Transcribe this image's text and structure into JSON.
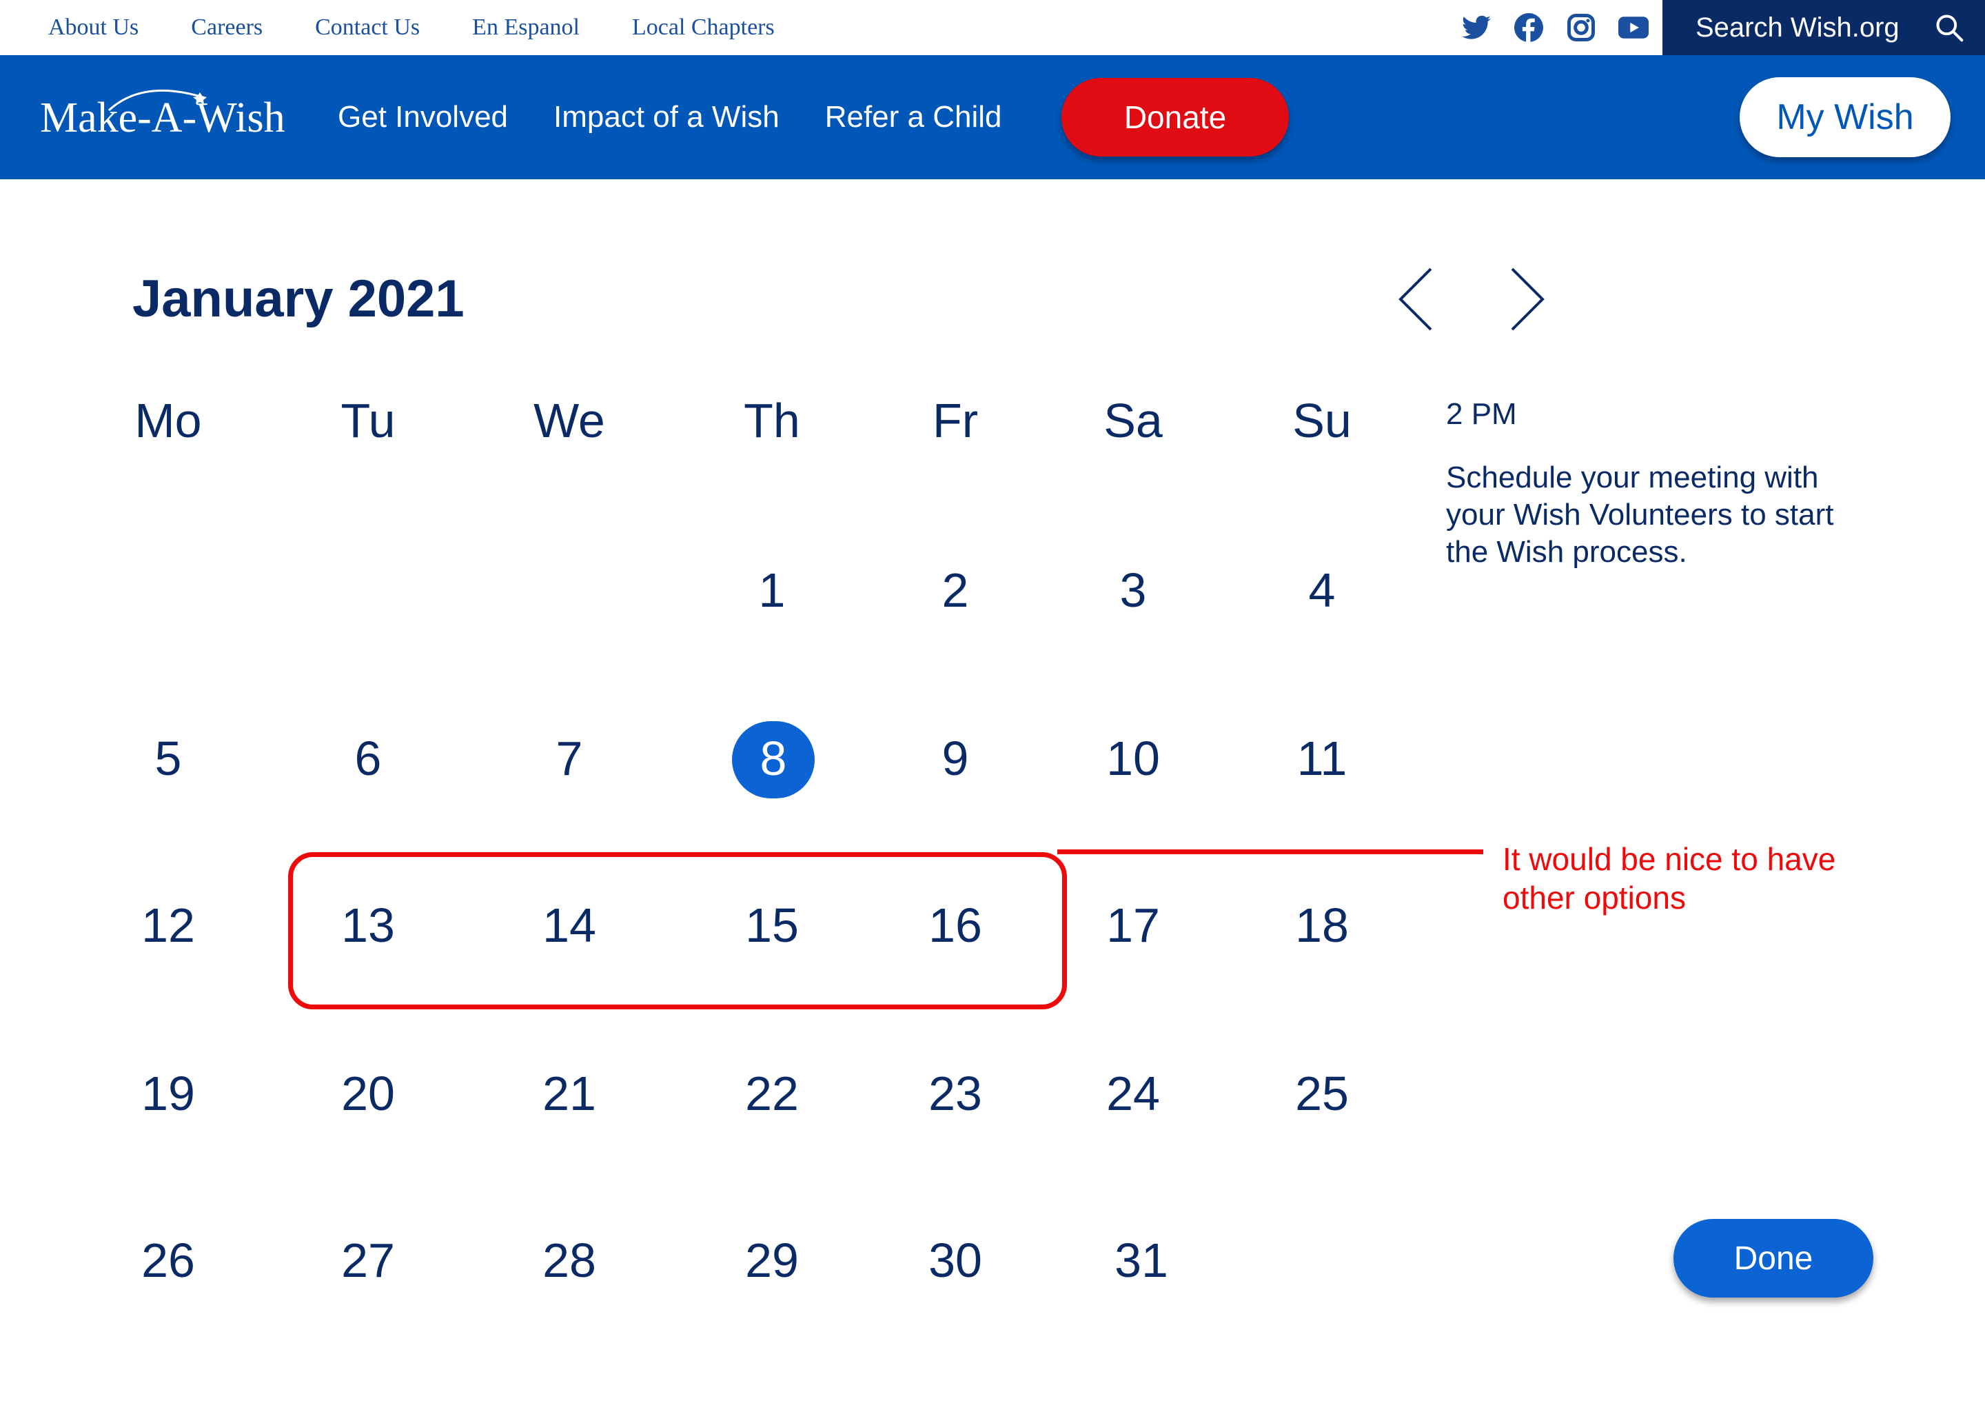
{
  "utility_nav": {
    "links": [
      "About Us",
      "Careers",
      "Contact Us",
      "En Espanol",
      "Local Chapters"
    ],
    "social_icons": [
      "twitter-icon",
      "facebook-icon",
      "instagram-icon",
      "youtube-icon"
    ],
    "search_label": "Search Wish.org"
  },
  "main_nav": {
    "logo_text": "Make-A-Wish",
    "links": [
      "Get Involved",
      "Impact of a Wish",
      "Refer a Child"
    ],
    "donate_label": "Donate",
    "my_wish_label": "My Wish"
  },
  "calendar": {
    "month_label": "January 2021",
    "weekdays": [
      "Mo",
      "Tu",
      "We",
      "Th",
      "Fr",
      "Sa",
      "Su"
    ],
    "days": [
      "1",
      "2",
      "3",
      "4",
      "5",
      "6",
      "7",
      "8",
      "9",
      "10",
      "11",
      "12",
      "13",
      "14",
      "15",
      "16",
      "17",
      "18",
      "19",
      "20",
      "21",
      "22",
      "23",
      "24",
      "25",
      "26",
      "27",
      "28",
      "29",
      "30",
      "31"
    ],
    "selected_day": "8"
  },
  "side_panel": {
    "time_label": "2 PM",
    "schedule_text": "Schedule your meeting with your Wish Volunteers to start the Wish process."
  },
  "annotation": {
    "note_text": "It would be nice to have other options"
  },
  "done_label": "Done",
  "colors": {
    "nav_blue": "#0057b8",
    "dark_navy": "#0a2a66",
    "donate_red": "#e00b13",
    "accent_blue": "#0b63d4",
    "annotation_red": "#ee0a0a"
  }
}
